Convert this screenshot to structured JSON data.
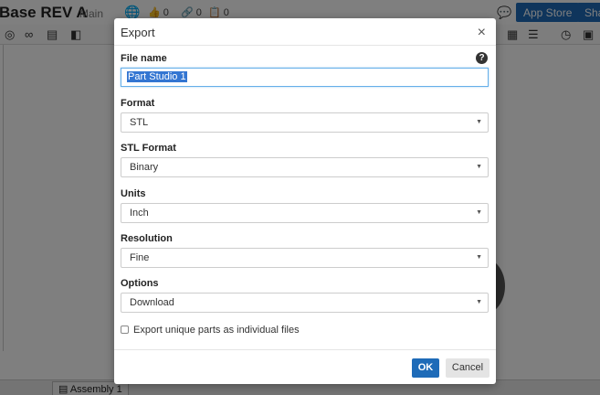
{
  "app": {
    "document_title": "Base REV A",
    "branch": "Main",
    "stats": {
      "likes": "0",
      "links": "0",
      "copies": "0"
    },
    "app_store_label": "App Store",
    "share_label": "Sha",
    "assembly_tab": "Assembly 1"
  },
  "dialog": {
    "title": "Export",
    "close_glyph": "×",
    "help_glyph": "?",
    "file_name": {
      "label": "File name",
      "value": "Part Studio 1"
    },
    "format": {
      "label": "Format",
      "value": "STL"
    },
    "stl_format": {
      "label": "STL Format",
      "value": "Binary"
    },
    "units": {
      "label": "Units",
      "value": "Inch"
    },
    "resolution": {
      "label": "Resolution",
      "value": "Fine"
    },
    "options": {
      "label": "Options",
      "value": "Download"
    },
    "checkbox_label": "Export unique parts as individual files",
    "checkbox_checked": false,
    "ok_label": "OK",
    "cancel_label": "Cancel"
  },
  "colors": {
    "primary": "#1e6bb8",
    "selection": "#3476d2"
  }
}
